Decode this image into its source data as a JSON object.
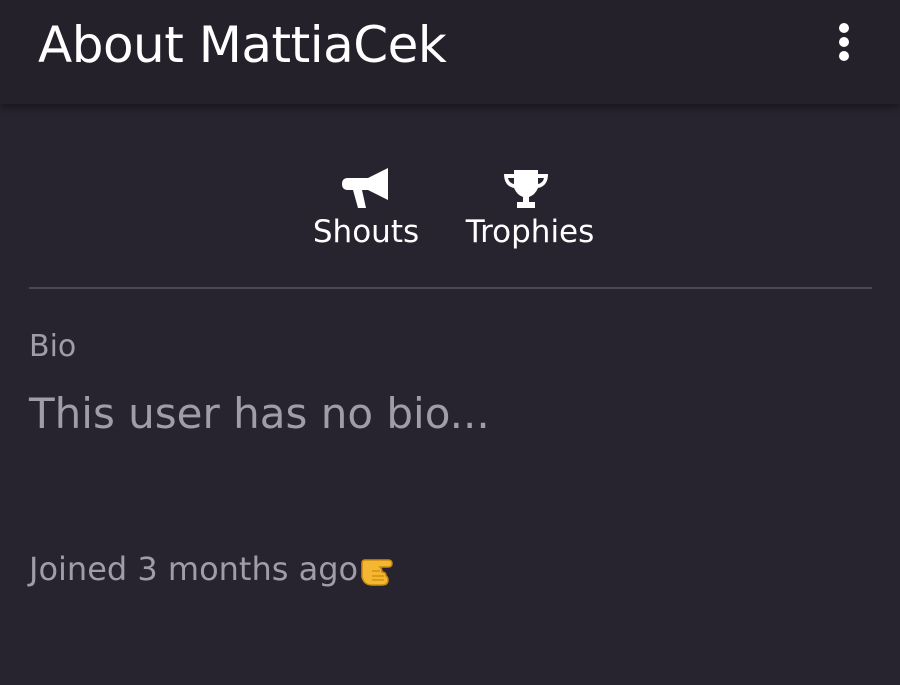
{
  "header": {
    "title": "About MattiaCek",
    "menu_icon": "more-vertical-icon"
  },
  "tabs": [
    {
      "label": "Shouts",
      "icon": "megaphone-icon"
    },
    {
      "label": "Trophies",
      "icon": "trophy-icon"
    }
  ],
  "bio": {
    "label": "Bio",
    "text": "This user has no bio..."
  },
  "joined": {
    "text": "Joined 3 months ago",
    "icon": "pointing-hand-icon"
  },
  "colors": {
    "background": "#27242f",
    "header_background": "#24212b",
    "primary_text": "#ffffff",
    "secondary_text": "#a09ca8",
    "divider": "#4a4654",
    "emoji_yellow": "#f5b731"
  }
}
